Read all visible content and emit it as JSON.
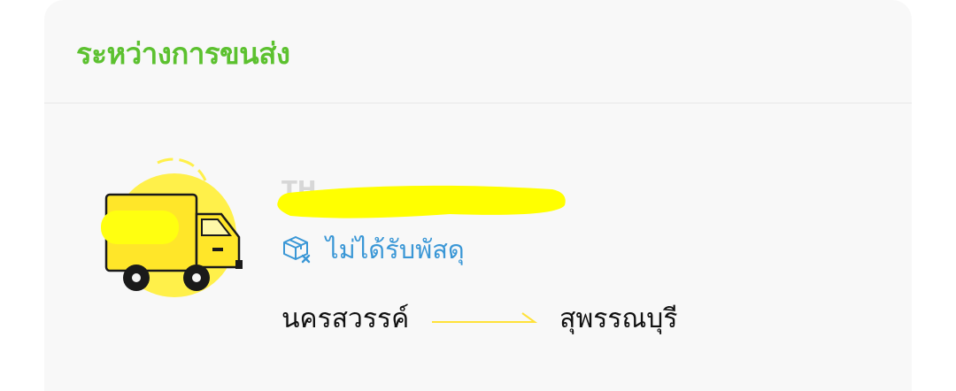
{
  "header": {
    "title": "ระหว่างการขนส่ง",
    "title_color": "#5cc12f"
  },
  "shipment": {
    "tracking_number": "TH",
    "tracking_redacted": true,
    "illustration": "delivery-truck-icon",
    "status_icon": "parcel-missing-icon",
    "status_text": "ไม่ได้รับพัสดุ",
    "status_color": "#3a97d6",
    "origin": "นครสวรรค์",
    "destination": "สุพรรณบุรี",
    "route_icon": "arrow-right-icon",
    "accent_color": "#ffe800"
  }
}
